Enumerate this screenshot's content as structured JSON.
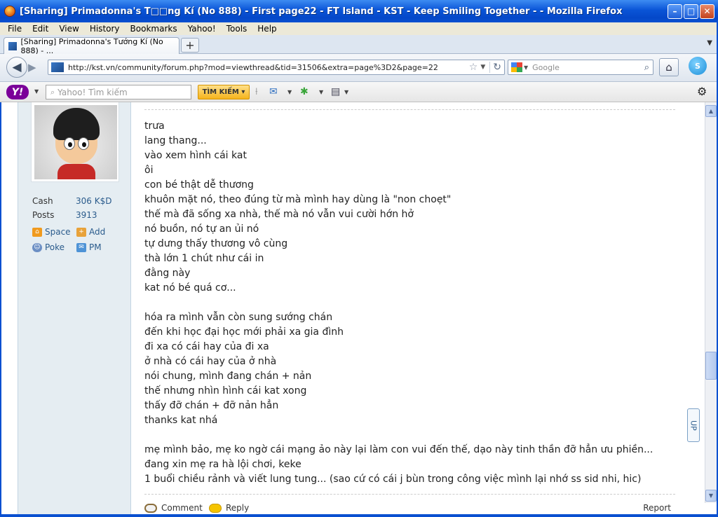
{
  "window": {
    "title": "[Sharing] Primadonna's T□□ng Kí (No 888) - First page22 - FT Island - KST - Keep Smiling Together - - Mozilla Firefox",
    "min_glyph": "–",
    "max_glyph": "□",
    "close_glyph": "✕"
  },
  "menu": [
    "File",
    "Edit",
    "View",
    "History",
    "Bookmarks",
    "Yahoo!",
    "Tools",
    "Help"
  ],
  "tabs": [
    {
      "label": "[Sharing] Primadonna's Tướng Kí (No 888) - ..."
    }
  ],
  "newtab_glyph": "+",
  "nav": {
    "url": "http://kst.vn/community/forum.php?mod=viewthread&tid=31506&extra=page%3D2&page=22",
    "search_placeholder": "Google"
  },
  "yahoo": {
    "logo": "Y!",
    "search_placeholder": "Yahoo! Tìm kiếm",
    "search_button": "TÌM KIẾM"
  },
  "user": {
    "stats": [
      {
        "label": "Cash",
        "value": "306 K$D"
      },
      {
        "label": "Posts",
        "value": "3913"
      }
    ],
    "links": [
      {
        "label": "Space",
        "icon": "home-icon"
      },
      {
        "label": "Add",
        "icon": "add-friend-icon"
      },
      {
        "label": "Poke",
        "icon": "poke-icon"
      },
      {
        "label": "PM",
        "icon": "mail-icon"
      }
    ]
  },
  "post": {
    "lines": [
      "trưa",
      "lang thang...",
      "vào xem hình cái kat",
      "ôi",
      "con bé thật dễ thương",
      "khuôn mặt nó, theo đúng từ mà mình hay dùng là \"non choẹt\"",
      "thế mà đã sống xa nhà, thế mà nó vẫn vui cười hớn hở",
      "nó buồn, nó tự an ủi nó",
      "tự dưng thấy thương vô cùng",
      "thà lớn 1 chút như cái in",
      "đằng này",
      "kat nó bé quá cơ...",
      "",
      "hóa ra mình vẫn còn sung sướng chán",
      "đến khi học đại học mới phải xa gia đình",
      "đi xa có cái hay của đi xa",
      "ở nhà có cái hay của ở nhà",
      "nói chung, mình đang chán + nản",
      "thế nhưng nhìn hình cái kat xong",
      "thấy đỡ chán + đỡ nản hẳn",
      "thanks kat nhá",
      "",
      "mẹ mình bảo, mẹ ko ngờ cái mạng ảo này lại làm con vui đến thế, dạo này tinh thần đỡ hẳn ưu phiền...",
      "đang xin mẹ ra hà lội chơi, keke",
      "1 buổi chiều rảnh và viết lung tung... (sao cứ có cái j bùn trong công việc mình lại nhớ ss sid nhi, hic)"
    ],
    "comment": "Comment",
    "reply": "Reply",
    "report": "Report"
  },
  "float_up": "UP"
}
